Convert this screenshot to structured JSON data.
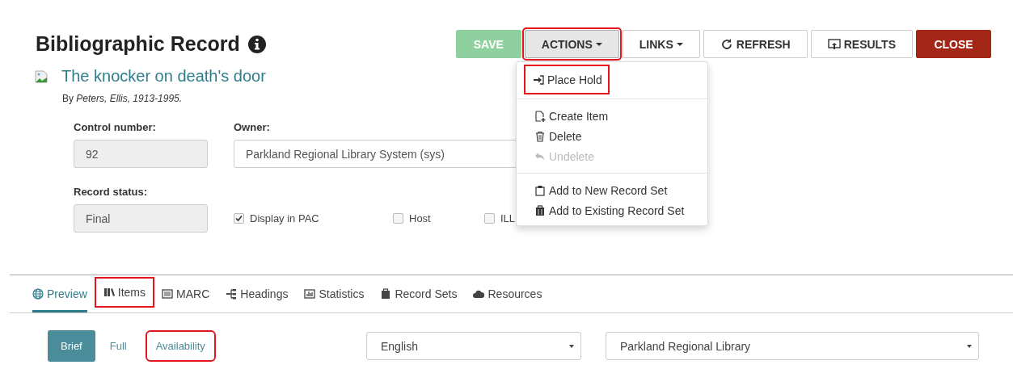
{
  "header": {
    "title": "Bibliographic Record"
  },
  "toolbar": [
    {
      "label": "SAVE",
      "kind": "save",
      "highlighted": false,
      "caret": false
    },
    {
      "label": "ACTIONS",
      "kind": "default",
      "highlighted": true,
      "caret": true,
      "pressed": true
    },
    {
      "label": "LINKS",
      "kind": "default",
      "highlighted": false,
      "caret": true,
      "pressed": false
    },
    {
      "label": "REFRESH",
      "kind": "refresh",
      "highlighted": false,
      "caret": false,
      "pressed": false
    },
    {
      "label": "RESULTS",
      "kind": "results",
      "highlighted": false,
      "caret": false,
      "pressed": false
    },
    {
      "label": "CLOSE",
      "kind": "close",
      "highlighted": false,
      "caret": false,
      "pressed": false
    }
  ],
  "actions_menu": {
    "groups": [
      [
        {
          "label": "Place Hold",
          "disabled": false,
          "highlighted": true
        }
      ],
      [
        {
          "label": "Create Item",
          "disabled": false,
          "highlighted": false
        },
        {
          "label": "Delete",
          "disabled": false,
          "highlighted": false
        },
        {
          "label": "Undelete",
          "disabled": true,
          "highlighted": false
        }
      ],
      [
        {
          "label": "Add to New Record Set",
          "disabled": false,
          "highlighted": false
        },
        {
          "label": "Add to Existing Record Set",
          "disabled": false,
          "highlighted": false
        }
      ]
    ]
  },
  "record": {
    "title": "The knocker on death's door",
    "byline": "By *Peters, Ellis, 1913-1995.*"
  },
  "form": {
    "control_number": {
      "label": "Control number:",
      "value": "92"
    },
    "owner": {
      "label": "Owner:",
      "value": "Parkland Regional Library System (sys)"
    },
    "record_status": {
      "label": "Record status:",
      "value": "Final"
    },
    "checkboxes": [
      {
        "label": "Display in PAC",
        "checked": true
      },
      {
        "label": "Host",
        "checked": false
      },
      {
        "label": "ILL",
        "checked": false
      }
    ]
  },
  "tabs": [
    {
      "label": "Preview",
      "selected": true,
      "highlighted": false
    },
    {
      "label": "Items",
      "selected": false,
      "highlighted": true
    },
    {
      "label": "MARC",
      "selected": false,
      "highlighted": false
    },
    {
      "label": "Headings",
      "selected": false,
      "highlighted": false
    },
    {
      "label": "Statistics",
      "selected": false,
      "highlighted": false
    },
    {
      "label": "Record Sets",
      "selected": false,
      "highlighted": false
    },
    {
      "label": "Resources",
      "selected": false,
      "highlighted": false
    }
  ],
  "view_modes": [
    {
      "label": "Brief",
      "selected": true,
      "highlighted": false
    },
    {
      "label": "Full",
      "selected": false,
      "highlighted": false
    },
    {
      "label": "Availability",
      "selected": false,
      "highlighted": true
    }
  ],
  "language_select": {
    "value": "English"
  },
  "library_select": {
    "value": "Parkland Regional Library"
  }
}
